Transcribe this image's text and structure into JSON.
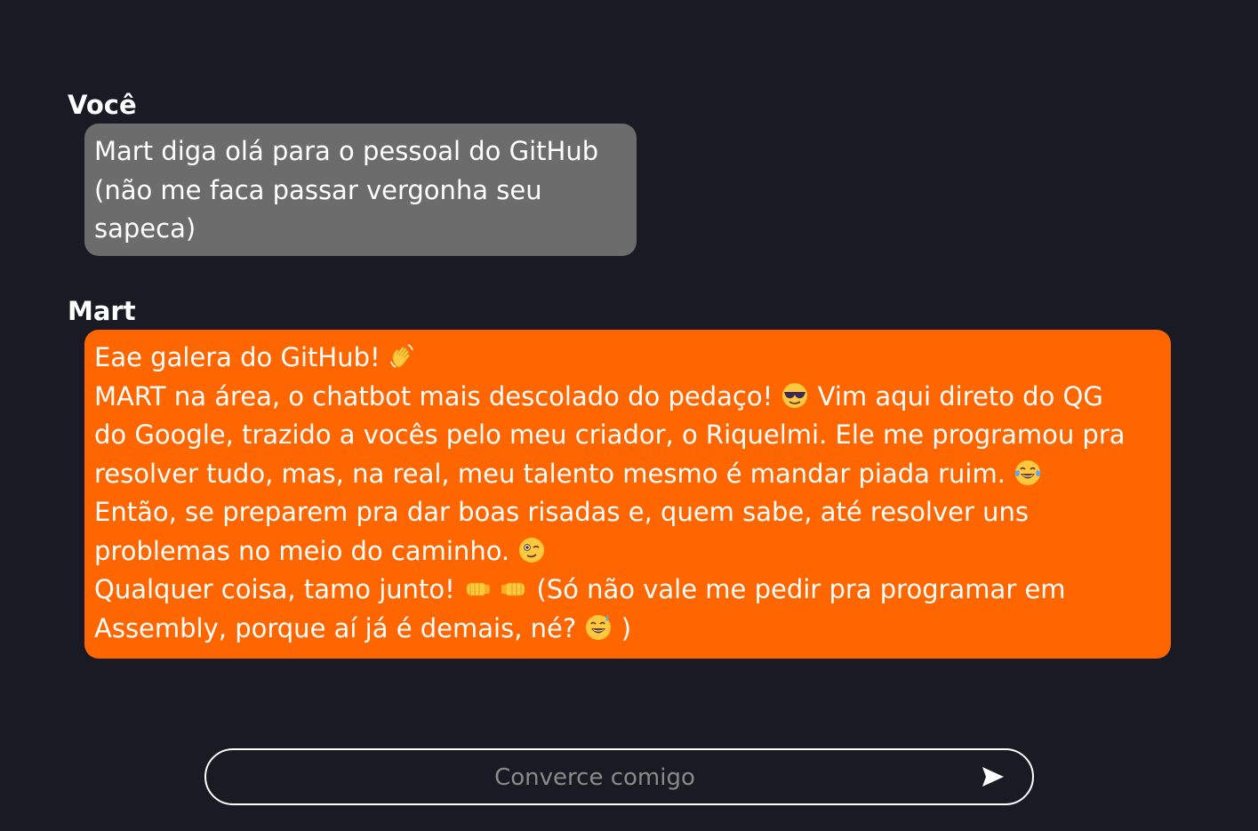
{
  "messages": {
    "user": {
      "author": "Você",
      "lines": [
        "Mart diga olá para o pessoal do GitHub",
        "(não me faca passar vergonha seu",
        "sapeca)"
      ]
    },
    "bot": {
      "author": "Mart",
      "l1": "Eae galera do GitHub!",
      "l2a": "MART na área, o chatbot mais descolado do pedaço!",
      "l2b": "Vim aqui direto do QG",
      "l3": "do Google, trazido a vocês pelo meu criador, o Riquelmi. Ele me programou pra",
      "l4": "resolver tudo, mas, na real, meu talento mesmo é mandar piada ruim.",
      "l5": "Então, se preparem pra dar boas risadas e, quem sabe, até resolver uns",
      "l6": "problemas no meio do caminho.",
      "l7a": "Qualquer coisa, tamo junto!",
      "l7b": "(Só não vale me pedir pra programar em",
      "l8a": "Assembly, porque aí já é demais, né?",
      "l8b": ")"
    }
  },
  "emojis": [
    "waving-hand",
    "smiling-face-with-sunglasses",
    "face-with-tears-of-joy",
    "winking-face",
    "left-facing-fist",
    "right-facing-fist",
    "grinning-face-with-sweat"
  ],
  "input": {
    "placeholder": "Converce comigo",
    "value": ""
  },
  "colors": {
    "background": "#1a1a24",
    "user_bubble": "#6c6c6c",
    "bot_bubble": "#ff6600"
  }
}
